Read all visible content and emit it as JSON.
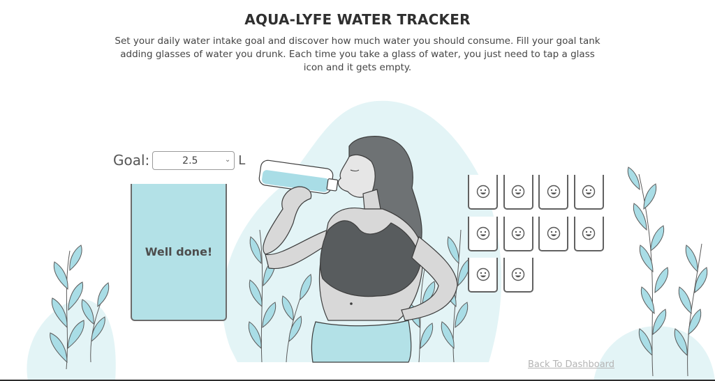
{
  "header": {
    "title": "AQUA-LYFE WATER TRACKER",
    "description": "Set your daily water intake goal and discover how much water you should consume. Fill your goal tank adding glasses of water you drunk. Each time you take a glass of water, you just need to tap a glass icon and it gets empty."
  },
  "goal": {
    "label": "Goal:",
    "selected_value": "2.5",
    "unit": "L"
  },
  "tank": {
    "fill_fraction": 1.0,
    "message": "Well done!"
  },
  "glasses": {
    "count": 10,
    "icon": "smiley-face-icon",
    "items": [
      {
        "state": "empty"
      },
      {
        "state": "empty"
      },
      {
        "state": "empty"
      },
      {
        "state": "empty"
      },
      {
        "state": "empty"
      },
      {
        "state": "empty"
      },
      {
        "state": "empty"
      },
      {
        "state": "empty"
      },
      {
        "state": "empty"
      },
      {
        "state": "empty"
      }
    ]
  },
  "footer": {
    "back_link": "Back To Dashboard"
  },
  "colors": {
    "water": "#b3e1e7",
    "blob": "#e3f4f6",
    "leaf": "#a9dde6",
    "stem": "#5a5a5a",
    "hair": "#6e7274",
    "top": "#585c5e",
    "skin": "#d8d8d8",
    "link": "#b4b4b4"
  }
}
